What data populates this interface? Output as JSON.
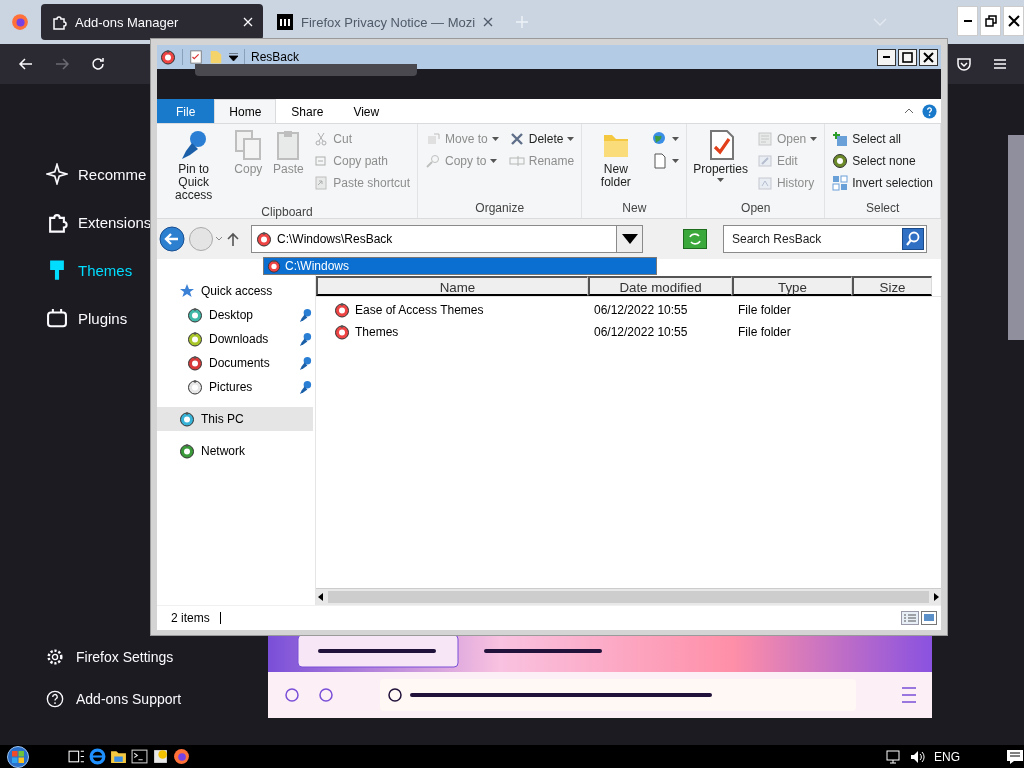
{
  "browser": {
    "tabs": [
      {
        "label": "Add-ons Manager",
        "kind": "addons",
        "selected": true
      },
      {
        "label": "Firefox Privacy Notice — Mozi",
        "kind": "site",
        "selected": false
      }
    ],
    "toolbar": [
      {
        "kind": "back",
        "disabled": false
      },
      {
        "kind": "forward",
        "disabled": true
      },
      {
        "kind": "reload",
        "disabled": false
      }
    ],
    "sidebar": [
      {
        "label": "Recomme",
        "kind": "sparkle",
        "selected": false
      },
      {
        "label": "Extensions",
        "kind": "puzzle",
        "selected": false
      },
      {
        "label": "Themes",
        "kind": "brush",
        "selected": true
      },
      {
        "label": "Plugins",
        "kind": "plug",
        "selected": false
      }
    ],
    "sidebar_footer": [
      {
        "label": "Firefox Settings",
        "kind": "gear"
      },
      {
        "label": "Add-ons Support",
        "kind": "help"
      }
    ]
  },
  "explorer": {
    "title": "ResBack",
    "ribbon_tabs": [
      {
        "label": "File",
        "kind": "file",
        "selected": false
      },
      {
        "label": "Home",
        "kind": "tab",
        "selected": true
      },
      {
        "label": "Share",
        "kind": "tab",
        "selected": false
      },
      {
        "label": "View",
        "kind": "tab",
        "selected": false
      }
    ],
    "ribbon_groups": [
      {
        "name": "Clipboard",
        "large": [
          {
            "label": "Pin to Quick access",
            "kind": "pin",
            "disabled": false,
            "menu": false
          },
          {
            "label": "Copy",
            "kind": "copy",
            "disabled": true,
            "menu": false
          },
          {
            "label": "Paste",
            "kind": "paste",
            "disabled": true,
            "menu": false
          }
        ],
        "columns": [
          [
            {
              "label": "Cut",
              "kind": "cut",
              "disabled": true,
              "menu": false
            },
            {
              "label": "Copy path",
              "kind": "copy-path",
              "disabled": true,
              "menu": false
            },
            {
              "label": "Paste shortcut",
              "kind": "paste-shortcut",
              "disabled": true,
              "menu": false
            }
          ]
        ]
      },
      {
        "name": "Organize",
        "columns": [
          [
            {
              "label": "Move to",
              "kind": "move-to",
              "disabled": true,
              "menu": true
            },
            {
              "label": "Copy to",
              "kind": "copy-to",
              "disabled": true,
              "menu": true
            }
          ],
          [
            {
              "label": "Delete",
              "kind": "delete",
              "disabled": false,
              "menu": true
            },
            {
              "label": "Rename",
              "kind": "rename",
              "disabled": true,
              "menu": false
            }
          ]
        ]
      },
      {
        "name": "New",
        "large": [
          {
            "label": "New folder",
            "kind": "folder",
            "disabled": false,
            "menu": false
          }
        ],
        "columns": [
          [
            {
              "kind": "globe",
              "disabled": false,
              "menu": true
            },
            {
              "kind": "page",
              "disabled": false,
              "menu": true
            }
          ]
        ]
      },
      {
        "name": "Open",
        "large": [
          {
            "label": "Properties",
            "kind": "properties",
            "disabled": false,
            "menu": true
          }
        ],
        "columns": [
          [
            {
              "label": "Open",
              "kind": "open",
              "disabled": true,
              "menu": true
            },
            {
              "label": "Edit",
              "kind": "edit",
              "disabled": true,
              "menu": false
            },
            {
              "label": "History",
              "kind": "history",
              "disabled": true,
              "menu": false
            }
          ]
        ]
      },
      {
        "name": "Select",
        "columns": [
          [
            {
              "label": "Select all",
              "kind": "select-all",
              "disabled": false,
              "menu": false
            },
            {
              "label": "Select none",
              "kind": "select-none",
              "disabled": false,
              "menu": false
            },
            {
              "label": "Invert selection",
              "kind": "invert",
              "disabled": false,
              "menu": false
            }
          ]
        ]
      }
    ],
    "address": {
      "value": "C:\\Windows\\ResBack",
      "suggestions": [
        {
          "label": "C:\\Windows",
          "selected": true
        }
      ]
    },
    "search": {
      "placeholder": "Search ResBack"
    },
    "nav_pane": [
      {
        "label": "Quick access",
        "kind": "star",
        "selected": false,
        "pinned": false,
        "children": [
          {
            "label": "Desktop",
            "kind": "orb",
            "color": "#3fb8a8",
            "pinned": true,
            "selected": false
          },
          {
            "label": "Downloads",
            "kind": "orb",
            "color": "#a8c628",
            "pinned": true,
            "selected": false
          },
          {
            "label": "Documents",
            "kind": "orb",
            "color": "#d83a3a",
            "pinned": true,
            "selected": false
          },
          {
            "label": "Pictures",
            "kind": "orb",
            "color": "#e6e6e6",
            "pinned": true,
            "selected": false
          }
        ]
      },
      {
        "label": "This PC",
        "kind": "orb",
        "color": "#36b3d6",
        "pinned": false,
        "selected": true
      },
      {
        "label": "Network",
        "kind": "orb",
        "color": "#3a9a3a",
        "pinned": false,
        "selected": false
      }
    ],
    "columns": [
      "Name",
      "Date modified",
      "Type",
      "Size"
    ],
    "rows": [
      {
        "cells": [
          "Ease of Access Themes",
          "06/12/2022 10:55",
          "File folder"
        ],
        "selected": false
      },
      {
        "cells": [
          "Themes",
          "06/12/2022 10:55",
          "File folder"
        ],
        "selected": false
      }
    ],
    "status": "2 items"
  },
  "taskbar": {
    "apps": [
      {
        "kind": "task-view"
      },
      {
        "kind": "ie"
      },
      {
        "kind": "explorer"
      },
      {
        "kind": "cmd"
      },
      {
        "kind": "helpapp"
      },
      {
        "kind": "firefox"
      }
    ],
    "tray": [
      {
        "kind": "network"
      },
      {
        "kind": "volume"
      }
    ],
    "language": "ENG"
  }
}
